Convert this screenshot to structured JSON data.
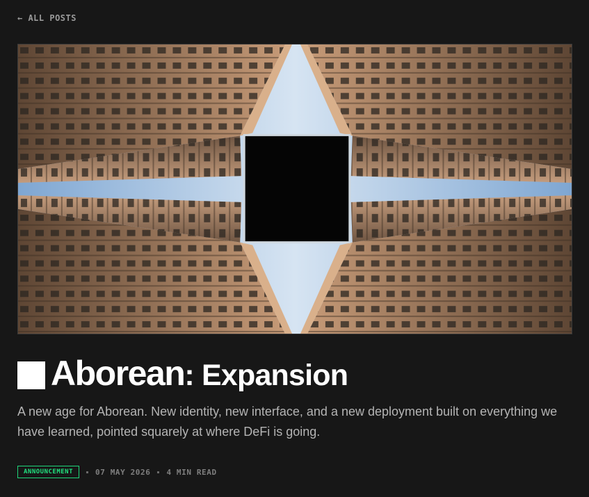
{
  "nav": {
    "back_label": "← ALL POSTS"
  },
  "post": {
    "title_brand": "Aborean",
    "title_rest": ": Expansion",
    "subtitle": "A new age for Aborean. New identity, new interface, and a new deployment built on everything we have learned, pointed squarely at where DeFi is going.",
    "tag": "ANNOUNCEMENT",
    "date": "07 MAY 2026",
    "read_time": "4 MIN READ"
  },
  "colors": {
    "background": "#171717",
    "accent": "#22e07f",
    "text": "#ffffff",
    "muted": "#b4b4b4"
  }
}
